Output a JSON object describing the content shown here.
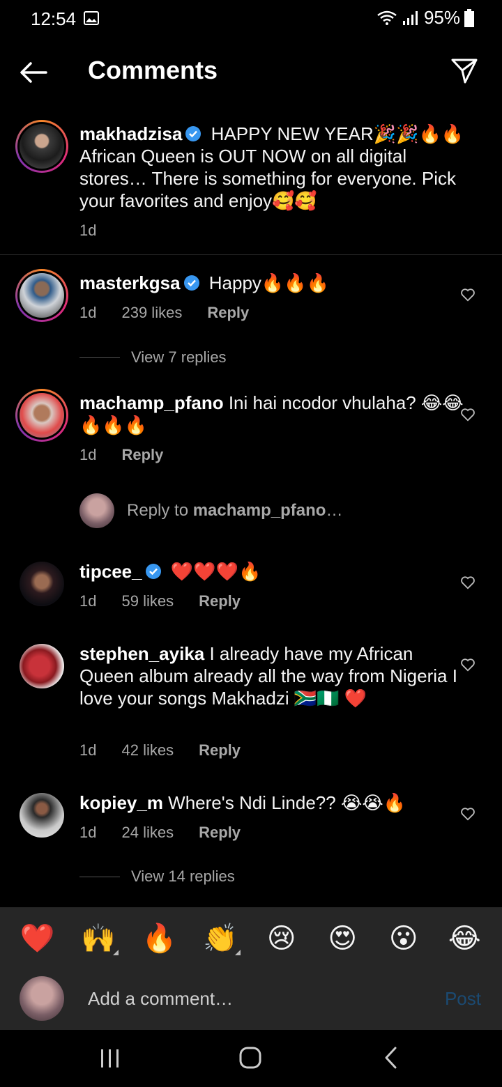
{
  "status": {
    "time": "12:54",
    "battery": "95%"
  },
  "header": {
    "title": "Comments"
  },
  "caption": {
    "username": "makhadzisa",
    "text": " HAPPY NEW YEAR🎉🎉🔥🔥 African Queen is OUT NOW on all digital stores… There is something for everyone. Pick your favorites and enjoy🥰🥰",
    "time": "1d"
  },
  "comments": [
    {
      "username": "masterkgsa",
      "text": " Happy🔥🔥🔥",
      "time": "1d",
      "likes": "239 likes",
      "reply": "Reply"
    },
    {
      "username": "machamp_pfano",
      "text": " Ini hai ncodor vhulaha? 😂😂🔥🔥🔥",
      "time": "1d",
      "reply": "Reply"
    },
    {
      "username": "tipcee_",
      "text": " ❤️❤️❤️🔥",
      "time": "1d",
      "likes": "59 likes",
      "reply": "Reply"
    },
    {
      "username": "stephen_ayika",
      "text": " I already have my African Queen album already all the way from Nigeria I love your songs Makhadzi 🇿🇦🇳🇬 ❤️",
      "time": "1d",
      "likes": "42 likes",
      "reply": "Reply"
    },
    {
      "username": "kopiey_m",
      "text": " Where's Ndi Linde?? 😭😭🔥",
      "time": "1d",
      "likes": "24 likes",
      "reply": "Reply"
    }
  ],
  "view_replies_1": "View 7 replies",
  "view_replies_2": "View 14 replies",
  "reply_prompt": {
    "prefix": "Reply to ",
    "target": "machamp_pfano",
    "suffix": "…"
  },
  "emoji_bar": [
    "❤️",
    "🙌",
    "🔥",
    "👏",
    "😢",
    "😍",
    "😮",
    "😂"
  ],
  "composer": {
    "placeholder": "Add a comment…",
    "post_label": "Post"
  },
  "colors": {
    "background": "#000000",
    "verified": "#3897f0",
    "post_disabled": "#1b4a72",
    "muted": "#a8a8a8"
  }
}
